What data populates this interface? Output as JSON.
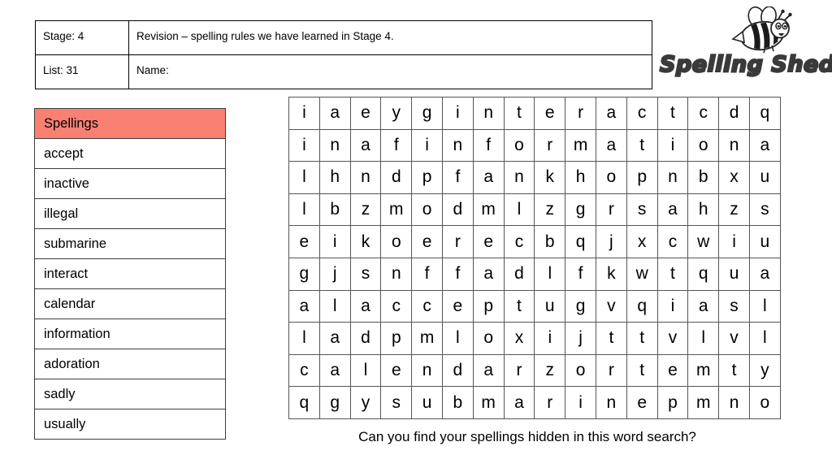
{
  "header": {
    "stage_label": "Stage: 4",
    "list_label": "List: 31",
    "title": "Revision – spelling rules we have learned in Stage 4.",
    "name_label": "Name:"
  },
  "logo": {
    "wordmark": "Spelling Shed",
    "bee_icon_name": "bee-icon"
  },
  "spellings": {
    "header": "Spellings",
    "words": [
      "accept",
      "inactive",
      "illegal",
      "submarine",
      "interact",
      "calendar",
      "information",
      "adoration",
      "sadly",
      "usually"
    ]
  },
  "wordsearch": {
    "columns": 16,
    "rows": 10,
    "grid": [
      [
        "i",
        "a",
        "e",
        "y",
        "g",
        "i",
        "n",
        "t",
        "e",
        "r",
        "a",
        "c",
        "t",
        "c",
        "d",
        "q"
      ],
      [
        "i",
        "n",
        "a",
        "f",
        "i",
        "n",
        "f",
        "o",
        "r",
        "m",
        "a",
        "t",
        "i",
        "o",
        "n",
        "a"
      ],
      [
        "l",
        "h",
        "n",
        "d",
        "p",
        "f",
        "a",
        "n",
        "k",
        "h",
        "o",
        "p",
        "n",
        "b",
        "x",
        "u"
      ],
      [
        "l",
        "b",
        "z",
        "m",
        "o",
        "d",
        "m",
        "l",
        "z",
        "g",
        "r",
        "s",
        "a",
        "h",
        "z",
        "s"
      ],
      [
        "e",
        "i",
        "k",
        "o",
        "e",
        "r",
        "e",
        "c",
        "b",
        "q",
        "j",
        "x",
        "c",
        "w",
        "i",
        "u"
      ],
      [
        "g",
        "j",
        "s",
        "n",
        "f",
        "f",
        "a",
        "d",
        "l",
        "f",
        "k",
        "w",
        "t",
        "q",
        "u",
        "a"
      ],
      [
        "a",
        "l",
        "a",
        "c",
        "c",
        "e",
        "p",
        "t",
        "u",
        "g",
        "v",
        "q",
        "i",
        "a",
        "s",
        "l"
      ],
      [
        "l",
        "a",
        "d",
        "p",
        "m",
        "l",
        "o",
        "x",
        "i",
        "j",
        "t",
        "t",
        "v",
        "l",
        "v",
        "l"
      ],
      [
        "c",
        "a",
        "l",
        "e",
        "n",
        "d",
        "a",
        "r",
        "z",
        "o",
        "r",
        "t",
        "e",
        "m",
        "t",
        "y"
      ],
      [
        "q",
        "g",
        "y",
        "s",
        "u",
        "b",
        "m",
        "a",
        "r",
        "i",
        "n",
        "e",
        "p",
        "m",
        "n",
        "o"
      ]
    ]
  },
  "prompt": "Can you find your spellings hidden in this word search?",
  "colors": {
    "header_highlight": "#fa8072",
    "grid_line": "#555555",
    "table_border": "#3b3b3b",
    "logo_gray": "#3a3a3a"
  }
}
